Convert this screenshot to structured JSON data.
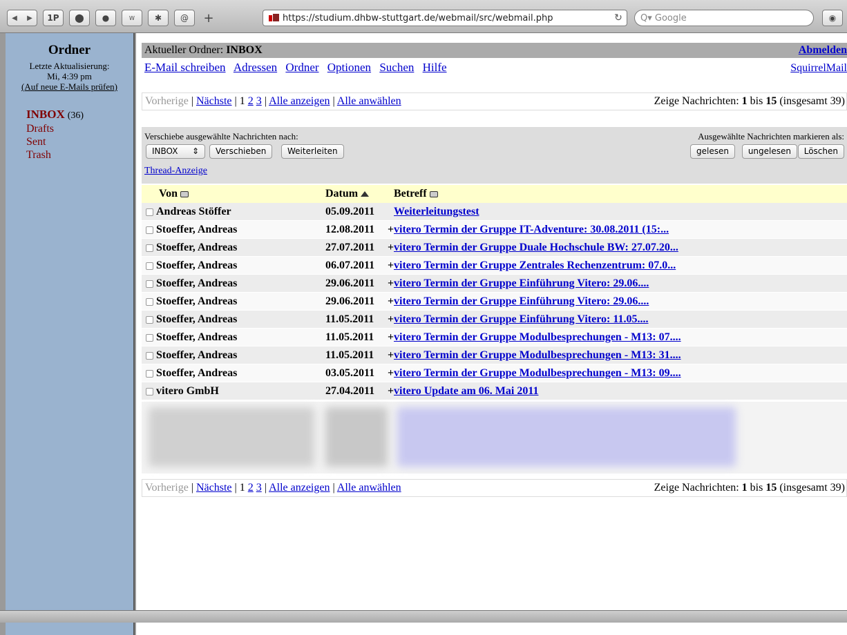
{
  "browser": {
    "url": "https://studium.dhbw-stuttgart.de/webmail/src/webmail.php",
    "search_placeholder": "Q▾ Google",
    "buttons": [
      "1P"
    ]
  },
  "sidebar": {
    "title": "Ordner",
    "last_update_label": "Letzte Aktualisierung:",
    "last_update_time": "Mi, 4:39 pm",
    "check_mail": "(Auf neue E-Mails prüfen)",
    "folders": [
      {
        "name": "INBOX",
        "count": "(36)"
      },
      {
        "name": "Drafts"
      },
      {
        "name": "Sent"
      },
      {
        "name": "Trash"
      }
    ]
  },
  "header": {
    "current_folder_label": "Aktueller Ordner:",
    "current_folder": "INBOX",
    "logout": "Abmelden",
    "brand": "SquirrelMail",
    "menu": [
      "E-Mail schreiben",
      "Adressen",
      "Ordner",
      "Optionen",
      "Suchen",
      "Hilfe"
    ]
  },
  "pager": {
    "prev": "Vorherige",
    "next": "Nächste",
    "pages": [
      "1",
      "2",
      "3"
    ],
    "show_all": "Alle anzeigen",
    "select_all": "Alle anwählen",
    "summary_prefix": "Zeige Nachrichten:",
    "from": "1",
    "to_label": "bis",
    "to": "15",
    "total": "(insgesamt 39)"
  },
  "actions": {
    "move_label": "Verschiebe ausgewählte Nachrichten nach:",
    "mark_label": "Ausgewählte Nachrichten markieren als:",
    "folder_select": "INBOX",
    "move_button": "Verschieben",
    "forward_button": "Weiterleiten",
    "read_button": "gelesen",
    "unread_button": "ungelesen",
    "delete_button": "Löschen",
    "thread_view": "Thread-Anzeige"
  },
  "table": {
    "columns": {
      "from": "Von",
      "date": "Datum",
      "subject": "Betreff"
    },
    "rows": [
      {
        "from": "Andreas Stöffer",
        "date": "05.09.2011",
        "plus": "",
        "subject": "Weiterleitungstest"
      },
      {
        "from": "Stoeffer, Andreas",
        "date": "12.08.2011",
        "plus": "+",
        "subject": "vitero Termin der Gruppe IT-Adventure: 30.08.2011 (15:..."
      },
      {
        "from": "Stoeffer, Andreas",
        "date": "27.07.2011",
        "plus": "+",
        "subject": "vitero Termin der Gruppe Duale Hochschule BW: 27.07.20..."
      },
      {
        "from": "Stoeffer, Andreas",
        "date": "06.07.2011",
        "plus": "+",
        "subject": "vitero Termin der Gruppe Zentrales Rechenzentrum: 07.0..."
      },
      {
        "from": "Stoeffer, Andreas",
        "date": "29.06.2011",
        "plus": "+",
        "subject": "vitero Termin der Gruppe Einführung Vitero: 29.06...."
      },
      {
        "from": "Stoeffer, Andreas",
        "date": "29.06.2011",
        "plus": "+",
        "subject": "vitero Termin der Gruppe Einführung Vitero: 29.06...."
      },
      {
        "from": "Stoeffer, Andreas",
        "date": "11.05.2011",
        "plus": "+",
        "subject": "vitero Termin der Gruppe Einführung Vitero: 11.05...."
      },
      {
        "from": "Stoeffer, Andreas",
        "date": "11.05.2011",
        "plus": "+",
        "subject": "vitero Termin der Gruppe Modulbesprechungen - M13: 07...."
      },
      {
        "from": "Stoeffer, Andreas",
        "date": "11.05.2011",
        "plus": "+",
        "subject": "vitero Termin der Gruppe Modulbesprechungen - M13: 31...."
      },
      {
        "from": "Stoeffer, Andreas",
        "date": "03.05.2011",
        "plus": "+",
        "subject": "vitero Termin der Gruppe Modulbesprechungen - M13: 09...."
      },
      {
        "from": "vitero GmbH",
        "date": "27.04.2011",
        "plus": "+",
        "subject": "vitero Update am 06. Mai 2011"
      }
    ]
  }
}
